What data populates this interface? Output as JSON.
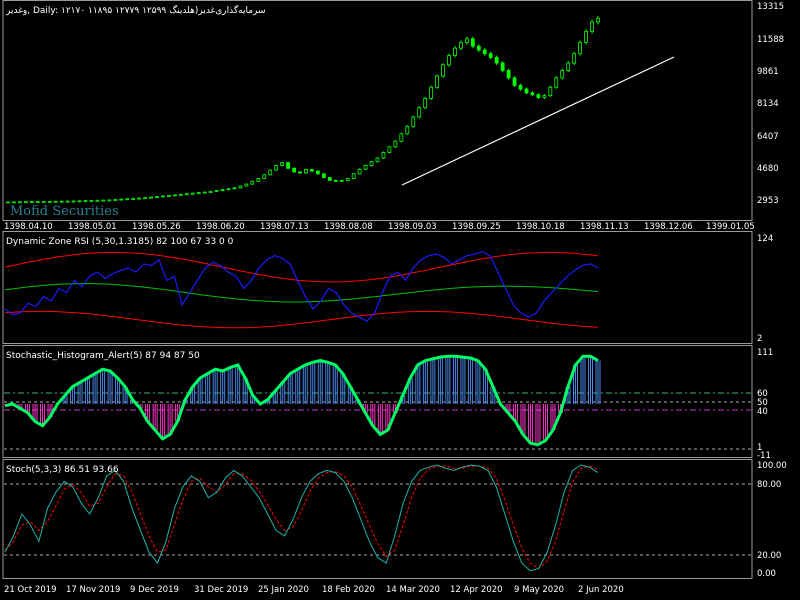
{
  "main": {
    "title": "وغدیر, Daily:  ۱۲۱۷۰ ۱۱۸۹۵ ۱۲۷۷۹ ۱۲۵۹۹ سرمایه‌گذاری‌غدیر(هلدینگ",
    "watermark": "Mofid Securities",
    "price_labels": [
      "13315",
      "11588",
      "9861",
      "8134",
      "6407",
      "4680",
      "2953"
    ],
    "date_labels": [
      "1398.04.10",
      "1398.05.01",
      "1398.05.26",
      "1398.06.20",
      "1398.07.13",
      "1398.08.08",
      "1398.09.03",
      "1398.09.25",
      "1398.10.18",
      "1398.11.13",
      "1398.12.06",
      "1399.01.05"
    ],
    "candle_color": "#00ff00",
    "trendline_color": "#ffffff"
  },
  "rsi": {
    "title": "Dynamic Zone RSI (5,30,1.3185) 82 100 67 33 0 0",
    "scale_labels": [
      "124",
      "2"
    ],
    "line_color": "#1a1aff",
    "band_color": "#ff0000",
    "mid_color": "#00c000"
  },
  "stoch_hist": {
    "title": "Stochastic_Histogram_Alert(5) 87 94 87 50",
    "scale_labels": [
      "111",
      "60",
      "50",
      "40",
      "1",
      "-11"
    ],
    "up_color": "#4a86e8",
    "down_color": "#ff33cc",
    "signal_up_color": "#00ff66",
    "signal_down_color": "#ff66ff"
  },
  "stoch": {
    "title": "Stoch(5,3,3) 86.51 93.66",
    "scale_labels": [
      "100.00",
      "80.00",
      "20.00",
      "0.00"
    ],
    "main_color": "#20b2aa",
    "signal_color": "#ff0000",
    "date_labels": [
      "21 Oct 2019",
      "17 Nov 2019",
      "9 Dec 2019",
      "31 Dec 2019",
      "25 Jan 2020",
      "18 Feb 2020",
      "14 Mar 2020",
      "12 Apr 2020",
      "9 May 2020",
      "2 Jun 2020"
    ]
  },
  "chart_data": {
    "type": "line",
    "title": "وغدیر, Daily:  ۱۲۱۷۰ ۱۱۸۹۵ ۱۲۷۷۹ ۱۲۵۹۹ سرمایه‌گذاری‌غدیر(هلدینگ",
    "price_close": [
      2740,
      2745,
      2750,
      2755,
      2760,
      2760,
      2765,
      2770,
      2775,
      2780,
      2785,
      2790,
      2800,
      2810,
      2820,
      2830,
      2840,
      2850,
      2870,
      2890,
      2910,
      2930,
      2950,
      2970,
      3000,
      3030,
      3060,
      3090,
      3120,
      3150,
      3180,
      3210,
      3240,
      3270,
      3300,
      3350,
      3400,
      3450,
      3500,
      3600,
      3700,
      3850,
      4000,
      4200,
      4450,
      4700,
      4850,
      4550,
      4350,
      4300,
      4480,
      4400,
      4250,
      4050,
      3900,
      3850,
      3900,
      4000,
      4250,
      4500,
      4700,
      4900,
      5100,
      5400,
      5700,
      6000,
      6400,
      6800,
      7300,
      7800,
      8300,
      8900,
      9500,
      10100,
      10600,
      11000,
      11300,
      11500,
      11100,
      10900,
      10700,
      10500,
      10200,
      9800,
      9400,
      9000,
      8800,
      8600,
      8500,
      8350,
      8450,
      8900,
      9400,
      9800,
      10200,
      10700,
      11300,
      11900,
      12400,
      12600
    ],
    "rsi": [
      35,
      28,
      30,
      42,
      38,
      50,
      45,
      60,
      55,
      70,
      62,
      75,
      80,
      72,
      78,
      82,
      85,
      80,
      90,
      88,
      95,
      70,
      75,
      40,
      55,
      70,
      85,
      92,
      88,
      80,
      75,
      60,
      70,
      85,
      95,
      100,
      97,
      90,
      70,
      50,
      35,
      45,
      60,
      55,
      40,
      30,
      25,
      20,
      30,
      55,
      75,
      80,
      70,
      85,
      95,
      100,
      102,
      98,
      90,
      95,
      100,
      102,
      105,
      100,
      80,
      60,
      40,
      30,
      25,
      30,
      45,
      55,
      65,
      75,
      82,
      88,
      90,
      85
    ],
    "stoch_hist": [
      48,
      50,
      45,
      40,
      30,
      25,
      35,
      50,
      60,
      70,
      75,
      80,
      85,
      90,
      88,
      80,
      70,
      55,
      45,
      30,
      20,
      10,
      15,
      30,
      55,
      70,
      80,
      85,
      90,
      88,
      92,
      95,
      80,
      60,
      50,
      55,
      65,
      75,
      85,
      90,
      95,
      98,
      100,
      98,
      95,
      85,
      70,
      55,
      40,
      25,
      15,
      20,
      40,
      60,
      80,
      95,
      100,
      102,
      104,
      105,
      105,
      104,
      103,
      100,
      90,
      70,
      50,
      40,
      30,
      15,
      5,
      3,
      8,
      20,
      40,
      70,
      95,
      105,
      105,
      100
    ],
    "stoch_main": [
      20,
      35,
      55,
      45,
      30,
      60,
      75,
      85,
      80,
      65,
      55,
      70,
      90,
      95,
      85,
      60,
      40,
      20,
      10,
      30,
      60,
      80,
      90,
      85,
      70,
      75,
      88,
      95,
      90,
      80,
      70,
      55,
      40,
      35,
      50,
      70,
      85,
      92,
      95,
      93,
      85,
      70,
      50,
      30,
      15,
      10,
      35,
      65,
      85,
      95,
      98,
      100,
      97,
      95,
      98,
      100,
      99,
      95,
      80,
      55,
      30,
      10,
      3,
      5,
      20,
      45,
      75,
      95,
      100,
      98,
      93
    ],
    "stoch_signal": [
      22,
      30,
      45,
      48,
      40,
      48,
      62,
      78,
      82,
      75,
      62,
      65,
      80,
      92,
      90,
      75,
      55,
      35,
      20,
      22,
      45,
      68,
      85,
      88,
      80,
      75,
      82,
      92,
      92,
      86,
      76,
      64,
      50,
      40,
      43,
      58,
      76,
      88,
      93,
      94,
      90,
      80,
      63,
      45,
      28,
      16,
      22,
      45,
      70,
      88,
      96,
      99,
      99,
      97,
      97,
      99,
      99,
      97,
      88,
      68,
      45,
      24,
      10,
      5,
      12,
      30,
      58,
      84,
      97,
      99,
      96
    ]
  }
}
